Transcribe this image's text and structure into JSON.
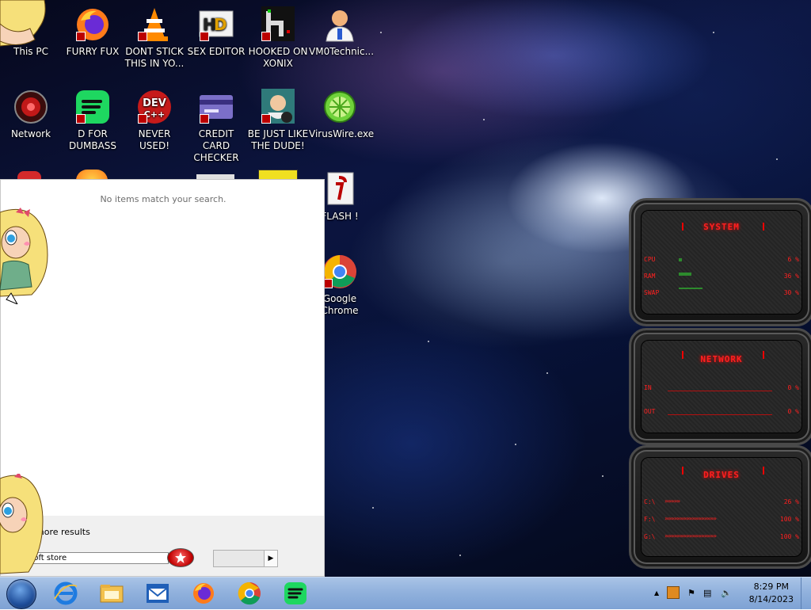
{
  "desktop": {
    "icons": [
      {
        "name": "this-pc",
        "label": "This PC"
      },
      {
        "name": "furry-fux",
        "label": "FURRY FUX"
      },
      {
        "name": "dont-stick",
        "label": "DONT STICK THIS IN YO..."
      },
      {
        "name": "sex-editor",
        "label": "SEX EDITOR"
      },
      {
        "name": "hooked-on-xonix",
        "label": "HOOKED ON XONIX"
      },
      {
        "name": "vm0technic",
        "label": "VM0Technic..."
      },
      {
        "name": "network",
        "label": "Network"
      },
      {
        "name": "d-for-dumbass",
        "label": "D FOR DUMBASS"
      },
      {
        "name": "never-used",
        "label": "NEVER USED!"
      },
      {
        "name": "credit-card-checker",
        "label": "CREDIT CARD CHECKER"
      },
      {
        "name": "be-just-like-the-dude",
        "label": "BE JUST LIKE THE DUDE!"
      },
      {
        "name": "viruswire",
        "label": "VirusWire.exe"
      },
      {
        "name": "flash",
        "label": "FLASH !"
      },
      {
        "name": "google-chrome",
        "label": "Google Chrome"
      }
    ]
  },
  "search_panel": {
    "no_items": "No items match your search.",
    "more_results": "more results",
    "search_value": "osoft store"
  },
  "gadgets": {
    "system": {
      "title": "SYSTEM",
      "rows": [
        {
          "key": "CPU",
          "value": "6 %",
          "level": 0.06
        },
        {
          "key": "RAM",
          "value": "36 %",
          "level": 0.36
        },
        {
          "key": "SWAP",
          "value": "30 %",
          "level": 0.3
        }
      ]
    },
    "network": {
      "title": "NETWORK",
      "rows": [
        {
          "key": "IN",
          "value": "0 %"
        },
        {
          "key": "OUT",
          "value": "0 %"
        }
      ]
    },
    "drives": {
      "title": "DRIVES",
      "rows": [
        {
          "key": "C:\\",
          "value": "26 %",
          "level": 0.26
        },
        {
          "key": "F:\\",
          "value": "100 %",
          "level": 1.0
        },
        {
          "key": "G:\\",
          "value": "100 %",
          "level": 1.0
        }
      ]
    }
  },
  "taskbar": {
    "pinned": [
      "internet-explorer",
      "file-explorer",
      "mail",
      "firefox",
      "chrome",
      "spotify"
    ],
    "clock_time": "8:29 PM",
    "clock_date": "8/14/2023"
  },
  "colors": {
    "gadget_red": "#ff2020",
    "taskbar": "#8fb0dc"
  }
}
